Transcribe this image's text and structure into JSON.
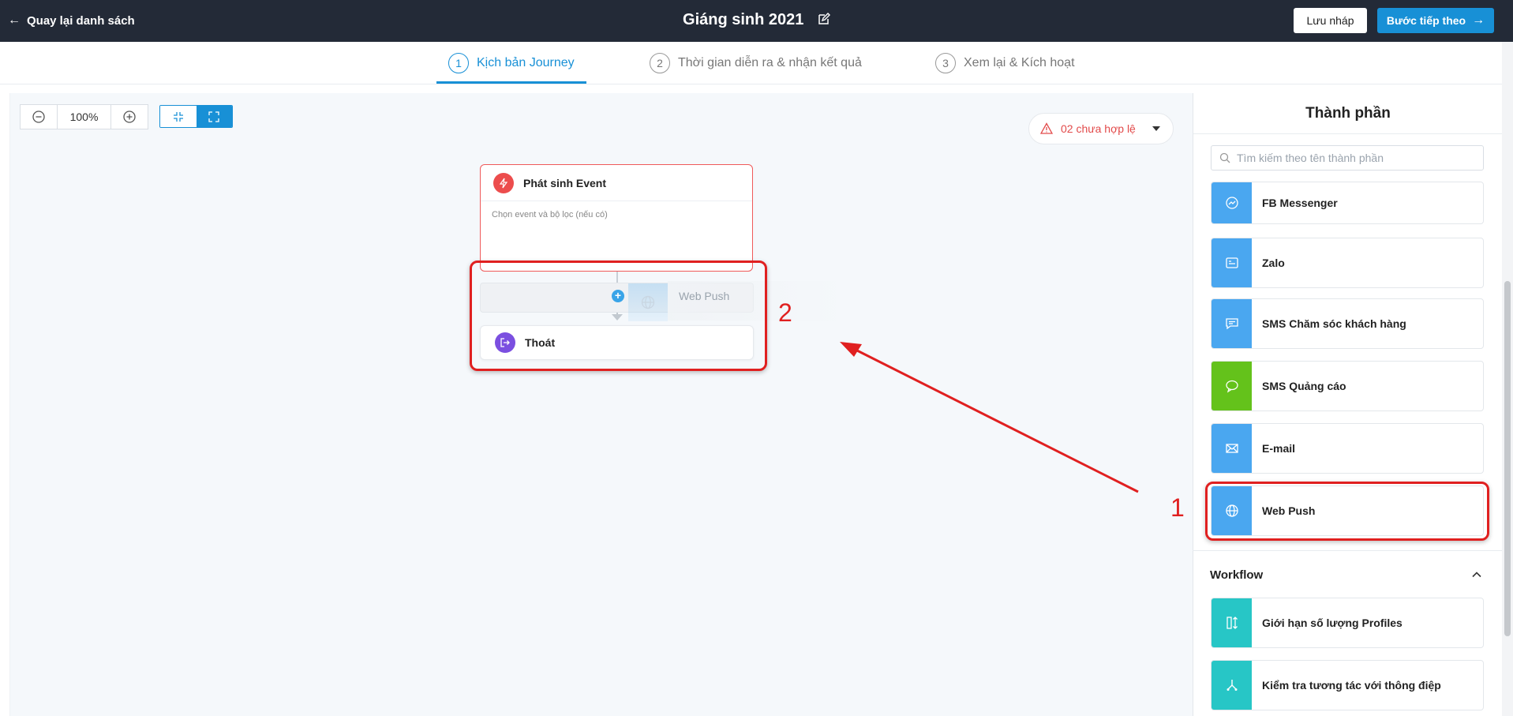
{
  "topbar": {
    "back_label": "Quay lại danh sách",
    "title": "Giáng sinh 2021",
    "draft_label": "Lưu nháp",
    "next_label": "Bước tiếp theo"
  },
  "steps": [
    {
      "num": "1",
      "label": "Kịch bản Journey",
      "active": true
    },
    {
      "num": "2",
      "label": "Thời gian diễn ra & nhận kết quả",
      "active": false
    },
    {
      "num": "3",
      "label": "Xem lại & Kích hoạt",
      "active": false
    }
  ],
  "canvas": {
    "zoom": "100%",
    "invalid_label": "02 chưa hợp lệ",
    "event_node": {
      "title": "Phát sinh Event",
      "desc": "Chọn event và bộ lọc (nếu có)"
    },
    "ghost_node": {
      "label": "Web Push"
    },
    "exit_node": {
      "title": "Thoát"
    },
    "annotations": {
      "one": "1",
      "two": "2"
    }
  },
  "panel": {
    "title": "Thành phần",
    "search_placeholder": "Tìm kiếm theo tên thành phần",
    "components": [
      {
        "label": "FB Messenger",
        "icon": "messenger-icon",
        "color": "#4aa7f0"
      },
      {
        "label": "Zalo",
        "icon": "zalo-icon",
        "color": "#4aa7f0"
      },
      {
        "label": "SMS Chăm sóc khách hàng",
        "icon": "sms-icon",
        "color": "#4aa7f0"
      },
      {
        "label": "SMS Quảng cáo",
        "icon": "chat-bubble-icon",
        "color": "#64c21b"
      },
      {
        "label": "E-mail",
        "icon": "mail-icon",
        "color": "#4aa7f0"
      },
      {
        "label": "Web Push",
        "icon": "globe-icon",
        "color": "#4aa7f0"
      }
    ],
    "workflow": {
      "title": "Workflow",
      "items": [
        {
          "label": "Giới hạn số lượng Profiles",
          "icon": "limit-icon",
          "color": "#27c6c6"
        },
        {
          "label": "Kiểm tra tương tác với thông điệp",
          "icon": "branch-icon",
          "color": "#27c6c6"
        }
      ]
    }
  },
  "colors": {
    "accent": "#1890d6",
    "error": "#e02020",
    "topbar": "#232a37"
  }
}
